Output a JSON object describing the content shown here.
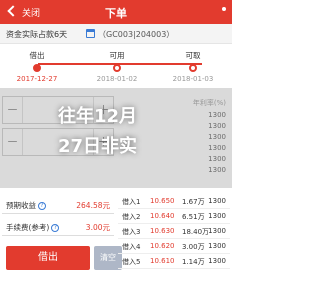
{
  "header": {
    "back_icon": "chevron-left",
    "close_label": "关闭",
    "title": "下单",
    "menu_icon": "dots"
  },
  "fund": {
    "days_label": "资金实际占款6天",
    "code_label": "（GC003|204003）"
  },
  "timeline": {
    "steps": [
      {
        "label": "借出",
        "date": "2017-12-27",
        "active": true
      },
      {
        "label": "可用",
        "date": "2018-01-02",
        "active": false
      },
      {
        "label": "可取",
        "date": "2018-01-03",
        "active": false
      }
    ]
  },
  "steppers": [
    {
      "minus": "－",
      "plus": "＋"
    },
    {
      "minus": "－",
      "plus": "＋"
    }
  ],
  "rate_table": {
    "header_right": "年利率(%)",
    "rows": [
      "1300",
      "1300",
      "1300",
      "1300",
      "1300",
      "1300"
    ]
  },
  "overlay": {
    "line1": "往年12月",
    "line2": "27日非实"
  },
  "income": {
    "label": "预期收益",
    "value": "264.58元"
  },
  "fee": {
    "label": "手续费(参考)",
    "value": "3.00元"
  },
  "buttons": {
    "borrow": "借出",
    "clear": "清空"
  },
  "borrow_rows": [
    {
      "name": "借入1",
      "rate": "10.650",
      "amount": "1.67万",
      "qty": "1300"
    },
    {
      "name": "借入2",
      "rate": "10.640",
      "amount": "6.51万",
      "qty": "1300"
    },
    {
      "name": "借入3",
      "rate": "10.630",
      "amount": "18.40万",
      "qty": "1300"
    },
    {
      "name": "借入4",
      "rate": "10.620",
      "amount": "3.00万",
      "qty": "1300"
    },
    {
      "name": "借入5",
      "rate": "10.610",
      "amount": "1.14万",
      "qty": "1300"
    }
  ]
}
